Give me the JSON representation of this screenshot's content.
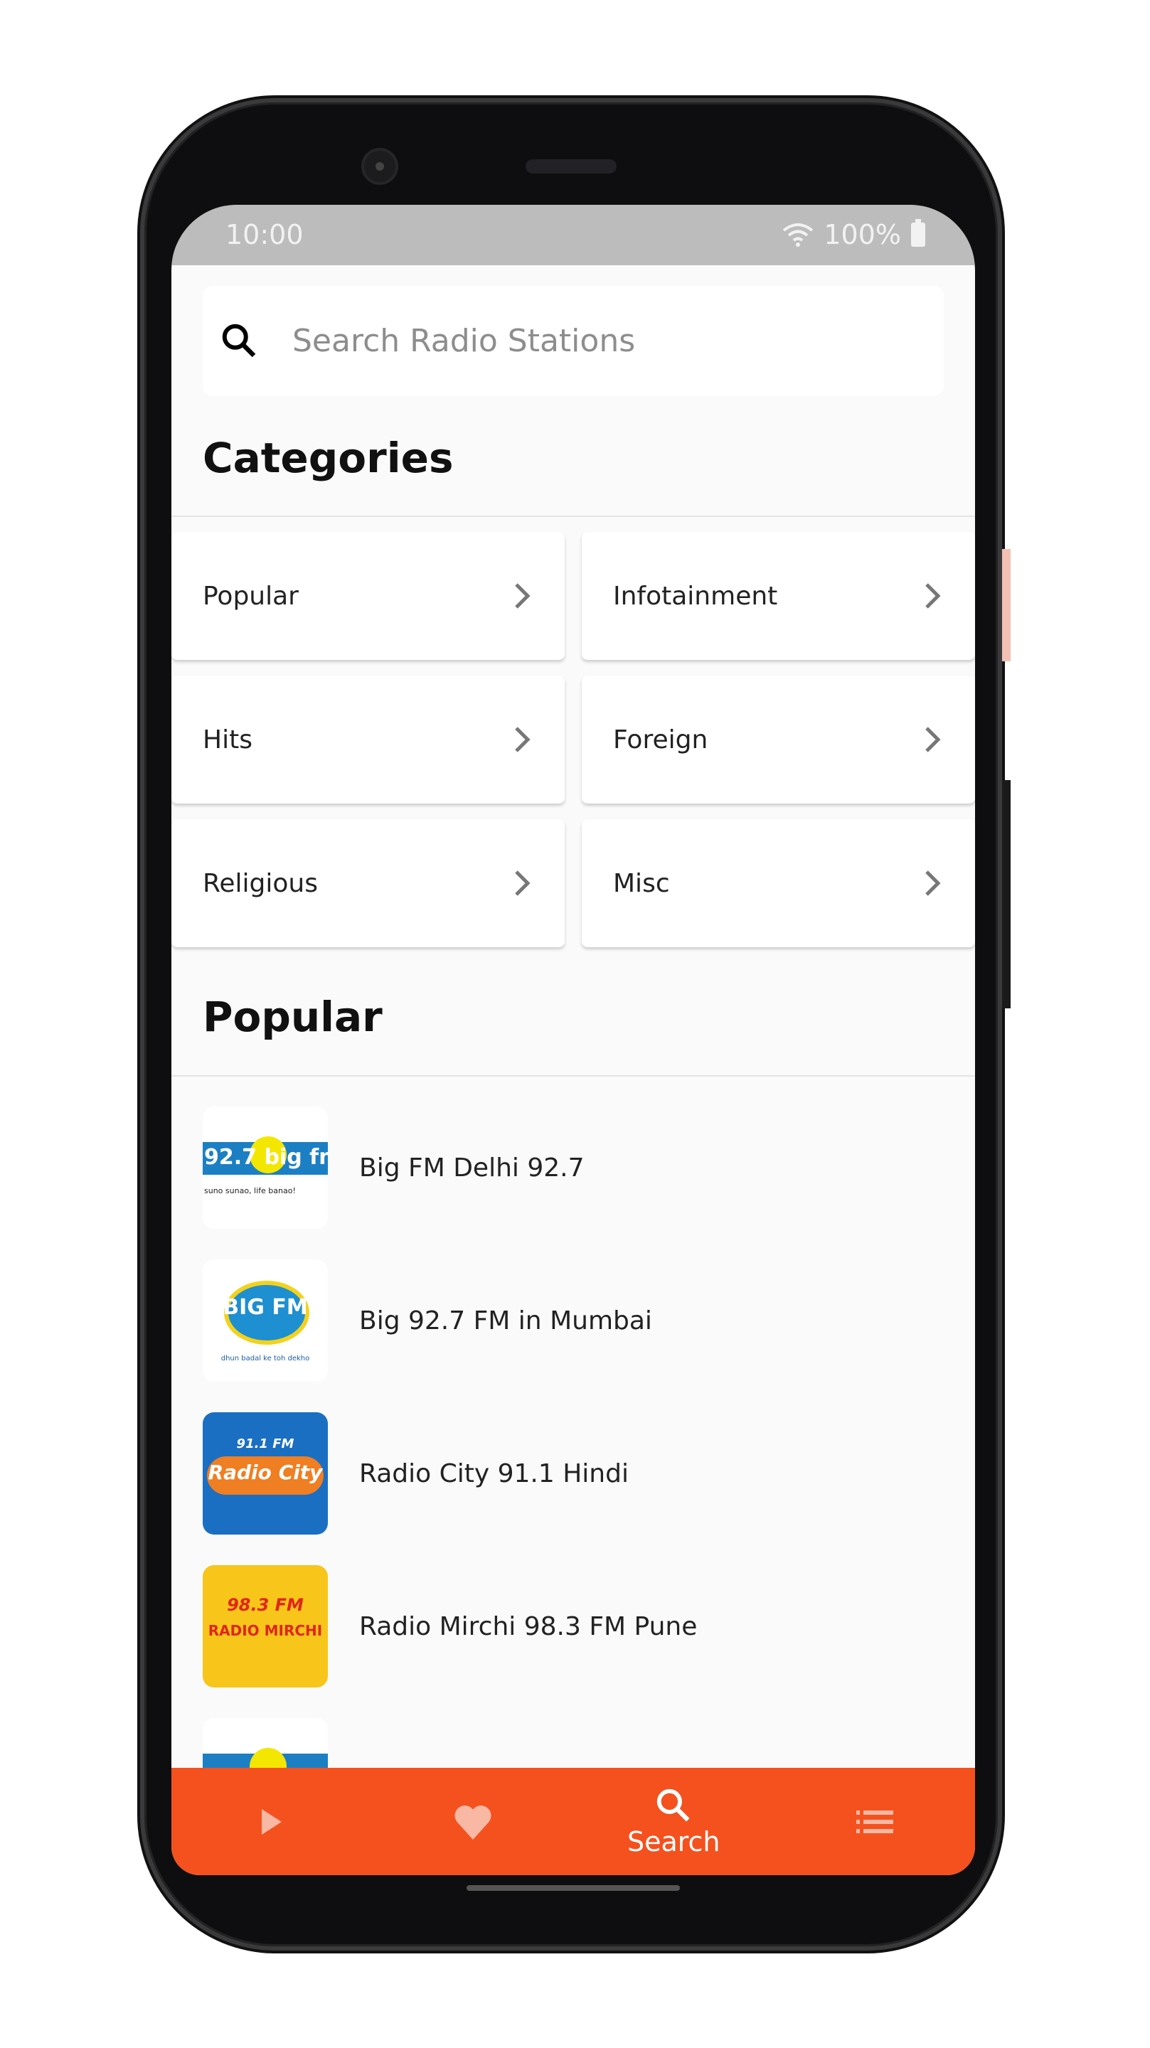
{
  "status_bar": {
    "time": "10:00",
    "battery": "100%"
  },
  "search": {
    "placeholder": "Search Radio Stations",
    "value": ""
  },
  "categories": {
    "title": "Categories",
    "items": [
      {
        "label": "Popular"
      },
      {
        "label": "Infotainment"
      },
      {
        "label": "Hits"
      },
      {
        "label": "Foreign"
      },
      {
        "label": "Religious"
      },
      {
        "label": "Misc"
      }
    ]
  },
  "popular": {
    "title": "Popular",
    "stations": [
      {
        "name": "Big FM Delhi 92.7",
        "logo": "big-fm-92.7",
        "logo_text": "92.7 big fm",
        "logo_tagline": "suno sunao, life banao!"
      },
      {
        "name": "Big 92.7 FM in Mumbai",
        "logo": "big-92.7-fm",
        "logo_text": "BIG FM",
        "logo_tagline": "dhun badal ke toh dekho"
      },
      {
        "name": "Radio City 91.1 Hindi",
        "logo": "radio-city",
        "logo_text": "Radio City",
        "logo_tagline": "91.1 FM"
      },
      {
        "name": "Radio Mirchi 98.3 FM Pune",
        "logo": "radio-mirchi",
        "logo_text": "RADIO MIRCHI",
        "logo_tagline": "98.3 FM"
      },
      {
        "name": "",
        "logo": "big-fm-92.7"
      }
    ]
  },
  "bottom_nav": {
    "tabs": [
      {
        "icon": "play-icon",
        "label": ""
      },
      {
        "icon": "heart-icon",
        "label": ""
      },
      {
        "icon": "search-icon",
        "label": "Search",
        "active": true
      },
      {
        "icon": "list-icon",
        "label": ""
      }
    ]
  },
  "colors": {
    "accent": "#f4511e",
    "status_bar": "#bcbcbc",
    "background": "#fafafa"
  }
}
